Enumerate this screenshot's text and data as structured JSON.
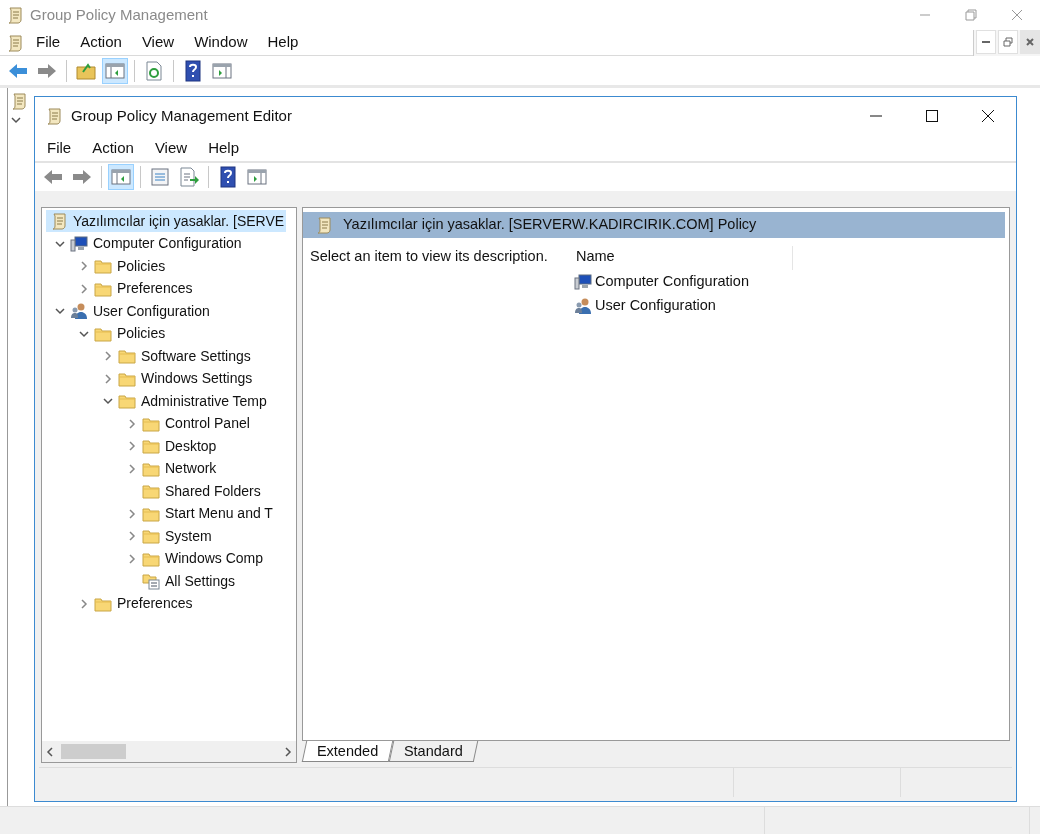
{
  "main_window": {
    "title": "Group Policy Management",
    "menu": [
      "File",
      "Action",
      "View",
      "Window",
      "Help"
    ],
    "toolbar": [
      {
        "kind": "back",
        "selected": false
      },
      {
        "kind": "forward",
        "selected": false
      },
      {
        "kind": "sep"
      },
      {
        "kind": "up",
        "selected": false
      },
      {
        "kind": "pane",
        "selected": true
      },
      {
        "kind": "sep"
      },
      {
        "kind": "refresh",
        "selected": false
      },
      {
        "kind": "sep"
      },
      {
        "kind": "help",
        "selected": false
      },
      {
        "kind": "panel",
        "selected": false
      }
    ]
  },
  "editor": {
    "title": "Group Policy Management Editor",
    "menu": [
      "File",
      "Action",
      "View",
      "Help"
    ],
    "toolbar": [
      {
        "kind": "back-grey",
        "selected": false
      },
      {
        "kind": "forward-grey",
        "selected": false
      },
      {
        "kind": "sep"
      },
      {
        "kind": "pane",
        "selected": true
      },
      {
        "kind": "sep"
      },
      {
        "kind": "props",
        "selected": false
      },
      {
        "kind": "export",
        "selected": false
      },
      {
        "kind": "sep"
      },
      {
        "kind": "help",
        "selected": false
      },
      {
        "kind": "panel",
        "selected": false
      }
    ],
    "tree": [
      {
        "label": "Yazılımcılar için yasaklar. [SERVE",
        "kind": "policy",
        "selected": true,
        "children": [
          {
            "label": "Computer Configuration",
            "kind": "computer",
            "expandable": true,
            "expanded": true,
            "selected": false,
            "children": [
              {
                "label": "Policies",
                "kind": "folder",
                "expandable": true,
                "expanded": false,
                "selected": false
              },
              {
                "label": "Preferences",
                "kind": "folder",
                "expandable": true,
                "expanded": false,
                "selected": false
              }
            ]
          },
          {
            "label": "User Configuration",
            "kind": "user",
            "expandable": true,
            "expanded": true,
            "selected": false,
            "children": [
              {
                "label": "Policies",
                "kind": "folder",
                "expandable": true,
                "expanded": true,
                "selected": false,
                "children": [
                  {
                    "label": "Software Settings",
                    "kind": "folder",
                    "expandable": true,
                    "expanded": false,
                    "selected": false
                  },
                  {
                    "label": "Windows Settings",
                    "kind": "folder",
                    "expandable": true,
                    "expanded": false,
                    "selected": false
                  },
                  {
                    "label": "Administrative Temp",
                    "kind": "folder",
                    "expandable": true,
                    "expanded": true,
                    "selected": false,
                    "children": [
                      {
                        "label": "Control Panel",
                        "kind": "folder",
                        "expandable": true,
                        "expanded": false,
                        "selected": false
                      },
                      {
                        "label": "Desktop",
                        "kind": "folder",
                        "expandable": true,
                        "expanded": false,
                        "selected": false
                      },
                      {
                        "label": "Network",
                        "kind": "folder",
                        "expandable": true,
                        "expanded": false,
                        "selected": false
                      },
                      {
                        "label": "Shared Folders",
                        "kind": "folder",
                        "expandable": false,
                        "expanded": false,
                        "selected": false
                      },
                      {
                        "label": "Start Menu and T",
                        "kind": "folder",
                        "expandable": true,
                        "expanded": false,
                        "selected": false
                      },
                      {
                        "label": "System",
                        "kind": "folder",
                        "expandable": true,
                        "expanded": false,
                        "selected": false
                      },
                      {
                        "label": "Windows Comp",
                        "kind": "folder",
                        "expandable": true,
                        "expanded": false,
                        "selected": false
                      },
                      {
                        "label": "All Settings",
                        "kind": "settings",
                        "expandable": false,
                        "expanded": false,
                        "selected": false
                      }
                    ]
                  }
                ]
              },
              {
                "label": "Preferences",
                "kind": "folder",
                "expandable": true,
                "expanded": false,
                "selected": false
              }
            ]
          }
        ]
      }
    ],
    "details": {
      "header": "Yazılımcılar için yasaklar. [SERVERW.KADIRCIRIK.COM] Policy",
      "description": "Select an item to view its description.",
      "columns": [
        "Name"
      ],
      "rows": [
        {
          "kind": "computer",
          "name": "Computer Configuration"
        },
        {
          "kind": "user",
          "name": "User Configuration"
        }
      ]
    },
    "tabs": [
      {
        "label": "Extended",
        "selected": true
      },
      {
        "label": "Standard",
        "selected": false
      }
    ]
  }
}
